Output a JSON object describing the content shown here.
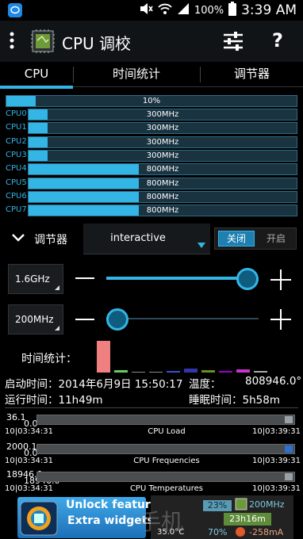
{
  "status": {
    "battery": "100%",
    "time": "3:39 AM"
  },
  "appbar": {
    "title": "CPU 调校"
  },
  "tabs": [
    {
      "label": "CPU",
      "active": true
    },
    {
      "label": "时间统计",
      "active": false
    },
    {
      "label": "调节器",
      "active": false
    }
  ],
  "total_load": {
    "text": "10%",
    "fraction": 0.1
  },
  "cores": [
    {
      "label": "CPU0",
      "freq": "300MHz",
      "fraction": 0.07
    },
    {
      "label": "CPU1",
      "freq": "300MHz",
      "fraction": 0.07
    },
    {
      "label": "CPU2",
      "freq": "300MHz",
      "fraction": 0.07
    },
    {
      "label": "CPU3",
      "freq": "300MHz",
      "fraction": 0.07
    },
    {
      "label": "CPU4",
      "freq": "800MHz",
      "fraction": 0.41
    },
    {
      "label": "CPU5",
      "freq": "800MHz",
      "fraction": 0.41
    },
    {
      "label": "CPU6",
      "freq": "800MHz",
      "fraction": 0.41
    },
    {
      "label": "CPU7",
      "freq": "800MHz",
      "fraction": 0.41
    }
  ],
  "governor": {
    "label": "调节器",
    "value": "interactive",
    "toggle_on": "关闭",
    "toggle_off": "开启"
  },
  "max_freq": {
    "value": "1.6GHz",
    "fraction": 1.0
  },
  "min_freq": {
    "value": "200MHz",
    "fraction": 0.0
  },
  "time_stats": {
    "label": "时间统计：",
    "bars": [
      {
        "height": 40,
        "color": "#f07f80"
      },
      {
        "height": 3,
        "color": "#66cc66"
      },
      {
        "height": 1,
        "color": "#888888"
      },
      {
        "height": 1,
        "color": "#888888"
      },
      {
        "height": 2,
        "color": "#3355cc"
      },
      {
        "height": 5,
        "color": "#3333aa"
      },
      {
        "height": 3,
        "color": "#6b8e23"
      },
      {
        "height": 2,
        "color": "#9900cc"
      },
      {
        "height": 4,
        "color": "#cc33cc"
      },
      {
        "height": 2,
        "color": "#aaaaaa"
      }
    ]
  },
  "info": {
    "uptime": "启动时间：2014年6月9日 15:50:17",
    "temp": "温度：",
    "temp_value": "808946.0°",
    "runtime": "运行时间：11h49m",
    "sleep": "睡眠时间：5h58m"
  },
  "graphs": [
    {
      "ymax": "36.1",
      "ymin": "0.0",
      "title": "CPU Load",
      "start": "10|03:34:31",
      "end": "10|03:39:31",
      "accent": "#9aa0a6"
    },
    {
      "ymax": "2000.1",
      "ymin": "0.0",
      "title": "CPU Frequencies",
      "start": "10|03:34:31",
      "end": "10|03:39:31",
      "accent": "#2f6fd0"
    },
    {
      "ymax": "18946.0",
      "ymin": "18946.0",
      "title": "CPU Temperatures",
      "start": "10|03:34:31",
      "end": "10|03:39:31",
      "accent": "#9aa0a6"
    }
  ],
  "ad": {
    "line1": "Unlock features",
    "line2": "Extra widgets",
    "w_pct": "23%",
    "w_freq": "200MHz",
    "w_time": "23h16m",
    "w_pct2": "70%",
    "w_current": "-258mA",
    "w_temp": "35.0°C",
    "watermark": "手机"
  }
}
